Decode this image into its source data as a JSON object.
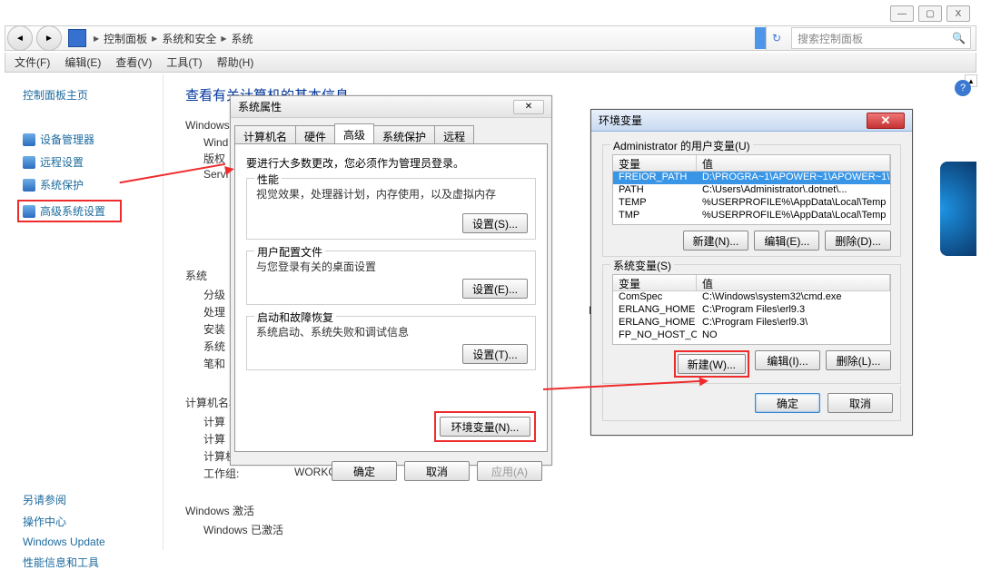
{
  "window_controls": {
    "min": "—",
    "max": "▢",
    "close": "X"
  },
  "breadcrumb": {
    "items": [
      "控制面板",
      "系统和安全",
      "系统"
    ]
  },
  "search": {
    "placeholder": "搜索控制面板"
  },
  "menubar": {
    "items": [
      "文件(F)",
      "编辑(E)",
      "查看(V)",
      "工具(T)",
      "帮助(H)"
    ]
  },
  "sidebar": {
    "title": "控制面板主页",
    "links": [
      "设备管理器",
      "远程设置",
      "系统保护",
      "高级系统设置"
    ],
    "see_also_title": "另请参阅",
    "see_also": [
      "操作中心",
      "Windows Update",
      "性能信息和工具"
    ]
  },
  "main": {
    "heading": "查看有关计算机的基本信息",
    "win_edition": "Windows 版本",
    "win_line1": "Wind",
    "win_ver": "版权",
    "serv": "Servi",
    "system_section": "系统",
    "rows": {
      "r1": "分级",
      "r2": "处理",
      "r3": "安装",
      "r4": "系统",
      "r5": "笔和"
    },
    "suffix_hz": "Hz",
    "domain_section": "计算机名称、域和工作组设置",
    "d_rows": {
      "r1": "计算",
      "r2": "计算",
      "r3": "计算",
      "r4_label": "工作组:",
      "r4_val": "WORKGROUP",
      "desc_label": "计算机描述:"
    },
    "activation_section": "Windows 激活",
    "act_line": "Windows 已激活"
  },
  "sys_props": {
    "title": "系统属性",
    "tabs": [
      "计算机名",
      "硬件",
      "高级",
      "系统保护",
      "远程"
    ],
    "notice": "要进行大多数更改，您必须作为管理员登录。",
    "perf_title": "性能",
    "perf_body": "视觉效果，处理器计划，内存使用，以及虚拟内存",
    "profiles_title": "用户配置文件",
    "profiles_body": "与您登录有关的桌面设置",
    "startup_title": "启动和故障恢复",
    "startup_body": "系统启动、系统失败和调试信息",
    "set_btn": "设置(S)...",
    "set_btn2": "设置(E)...",
    "set_btn3": "设置(T)...",
    "envvar_btn": "环境变量(N)...",
    "ok": "确定",
    "cancel": "取消",
    "apply": "应用(A)"
  },
  "envdlg": {
    "title": "环境变量",
    "user_group": "Administrator 的用户变量(U)",
    "col_var": "变量",
    "col_val": "值",
    "user_rows": [
      {
        "v": "FREIOR_PATH",
        "val": "D:\\PROGRA~1\\APOWER~1\\APOWER~1\\V..."
      },
      {
        "v": "PATH",
        "val": "C:\\Users\\Administrator\\.dotnet\\..."
      },
      {
        "v": "TEMP",
        "val": "%USERPROFILE%\\AppData\\Local\\Temp"
      },
      {
        "v": "TMP",
        "val": "%USERPROFILE%\\AppData\\Local\\Temp"
      }
    ],
    "sys_group": "系统变量(S)",
    "sys_rows": [
      {
        "v": "ComSpec",
        "val": "C:\\Windows\\system32\\cmd.exe"
      },
      {
        "v": "ERLANG_HOME",
        "val": "C:\\Program Files\\erl9.3"
      },
      {
        "v": "ERLANG_HOME",
        "val": "C:\\Program Files\\erl9.3\\"
      },
      {
        "v": "FP_NO_HOST_C...",
        "val": "NO"
      }
    ],
    "new": "新建(N)...",
    "edit_u": "编辑(E)...",
    "del_u": "删除(D)...",
    "new2": "新建(W)...",
    "edit_s": "编辑(I)...",
    "del_s": "删除(L)...",
    "ok": "确定",
    "cancel": "取消"
  }
}
